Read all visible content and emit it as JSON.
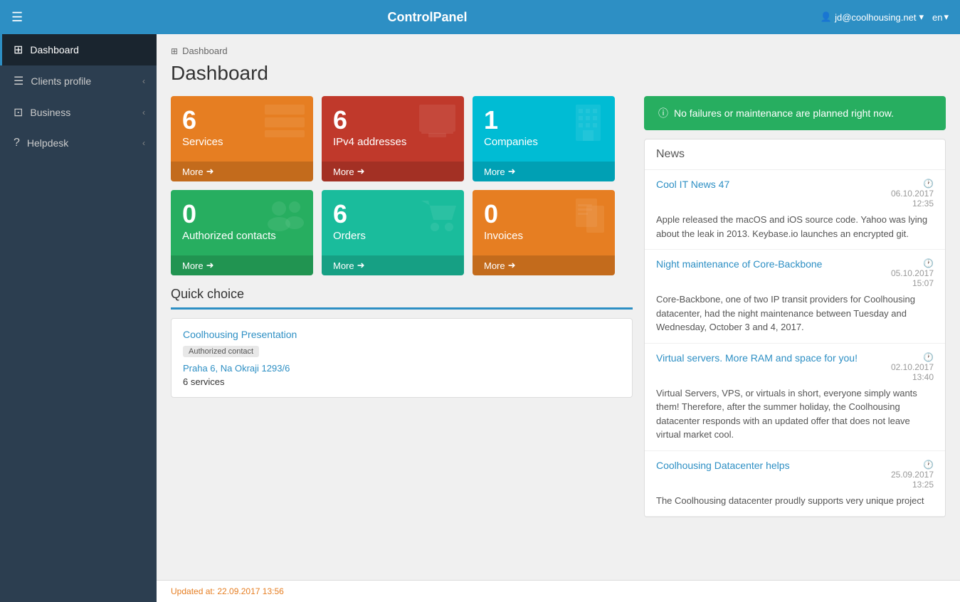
{
  "header": {
    "logo": "ControlPanel",
    "menu_icon": "☰",
    "user": "jd@coolhousing.net",
    "user_icon": "👤",
    "lang": "en",
    "lang_arrow": "▾",
    "user_arrow": "▾"
  },
  "sidebar": {
    "items": [
      {
        "id": "dashboard",
        "label": "Dashboard",
        "icon": "⊞",
        "active": true,
        "arrow": ""
      },
      {
        "id": "clients-profile",
        "label": "Clients profile",
        "icon": "☰",
        "active": false,
        "arrow": "‹"
      },
      {
        "id": "business",
        "label": "Business",
        "icon": "⊡",
        "active": false,
        "arrow": "‹"
      },
      {
        "id": "helpdesk",
        "label": "Helpdesk",
        "icon": "?",
        "active": false,
        "arrow": "‹"
      }
    ]
  },
  "breadcrumb": {
    "icon": "⊞",
    "label": "Dashboard"
  },
  "page_title": "Dashboard",
  "stat_cards": [
    {
      "id": "services",
      "count": "6",
      "label": "Services",
      "more": "More",
      "color": "card-orange",
      "icon": "🖥"
    },
    {
      "id": "ipv4",
      "count": "6",
      "label": "IPv4 addresses",
      "more": "More",
      "color": "card-red",
      "icon": "🖥"
    },
    {
      "id": "companies",
      "count": "1",
      "label": "Companies",
      "more": "More",
      "color": "card-cyan",
      "icon": "🏢"
    },
    {
      "id": "contacts",
      "count": "0",
      "label": "Authorized contacts",
      "more": "More",
      "color": "card-green",
      "icon": "👥"
    },
    {
      "id": "orders",
      "count": "6",
      "label": "Orders",
      "more": "More",
      "color": "card-teal",
      "icon": "🛒"
    },
    {
      "id": "invoices",
      "count": "0",
      "label": "Invoices",
      "more": "More",
      "color": "card-orange2",
      "icon": "📄"
    }
  ],
  "status_banner": {
    "icon": "ℹ",
    "text": "No failures or maintenance are planned right now."
  },
  "news": {
    "title": "News",
    "items": [
      {
        "id": "news-1",
        "title": "Cool IT News 47",
        "date": "06.10.2017",
        "time": "12:35",
        "body": "Apple released the macOS and iOS source code. Yahoo was lying about the leak in 2013. Keybase.io launches an encrypted git."
      },
      {
        "id": "news-2",
        "title": "Night maintenance of Core-Backbone",
        "date": "05.10.2017",
        "time": "15:07",
        "body": "Core-Backbone, one of two IP transit providers for Coolhousing datacenter, had the night maintenance between Tuesday and Wednesday, October 3 and 4, 2017."
      },
      {
        "id": "news-3",
        "title": "Virtual servers. More RAM and space for you!",
        "date": "02.10.2017",
        "time": "13:40",
        "body": "Virtual Servers, VPS, or virtuals in short, everyone simply wants them! Therefore, after the summer holiday, the Coolhousing datacenter responds with an updated offer that does not leave virtual market cool."
      },
      {
        "id": "news-4",
        "title": "Coolhousing Datacenter helps",
        "date": "25.09.2017",
        "time": "13:25",
        "body": "The Coolhousing datacenter proudly supports very unique project"
      }
    ]
  },
  "quick_choice": {
    "title": "Quick choice",
    "card": {
      "name": "Coolhousing Presentation",
      "badge": "Authorized contact",
      "address": "Praha 6, Na Okraji 1293/6",
      "services": "6 services"
    }
  },
  "footer": {
    "text": "Updated at: 22.09.2017 13:56"
  }
}
